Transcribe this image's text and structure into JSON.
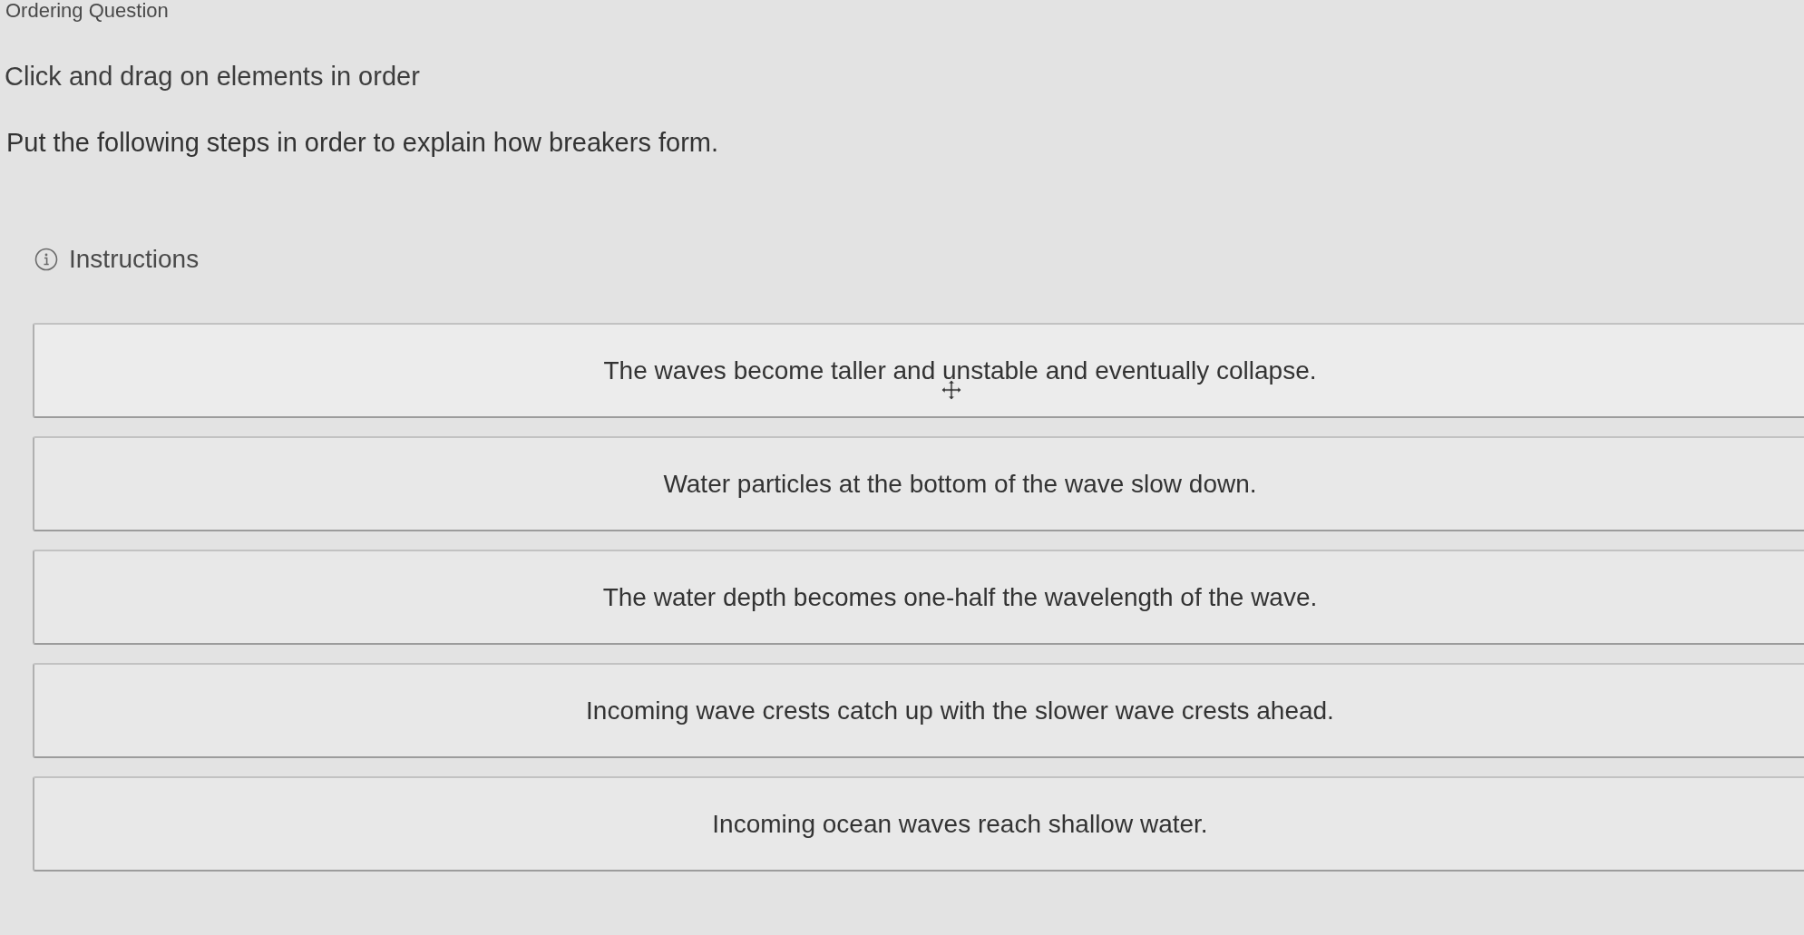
{
  "page": {
    "title": "Ordering Question",
    "prompt": "Click and drag on elements in order",
    "question": "Put the following steps in order to explain how breakers form.",
    "instructions_link": "Instructions"
  },
  "items": [
    {
      "text": "The waves become taller and unstable and eventually collapse.",
      "hovered": true
    },
    {
      "text": "Water particles at the bottom of the wave slow down.",
      "hovered": false
    },
    {
      "text": "The water depth becomes one-half the wavelength of the wave.",
      "hovered": false
    },
    {
      "text": "Incoming wave crests catch up with the slower wave crests ahead.",
      "hovered": false
    },
    {
      "text": "Incoming ocean waves reach shallow water.",
      "hovered": false
    }
  ]
}
